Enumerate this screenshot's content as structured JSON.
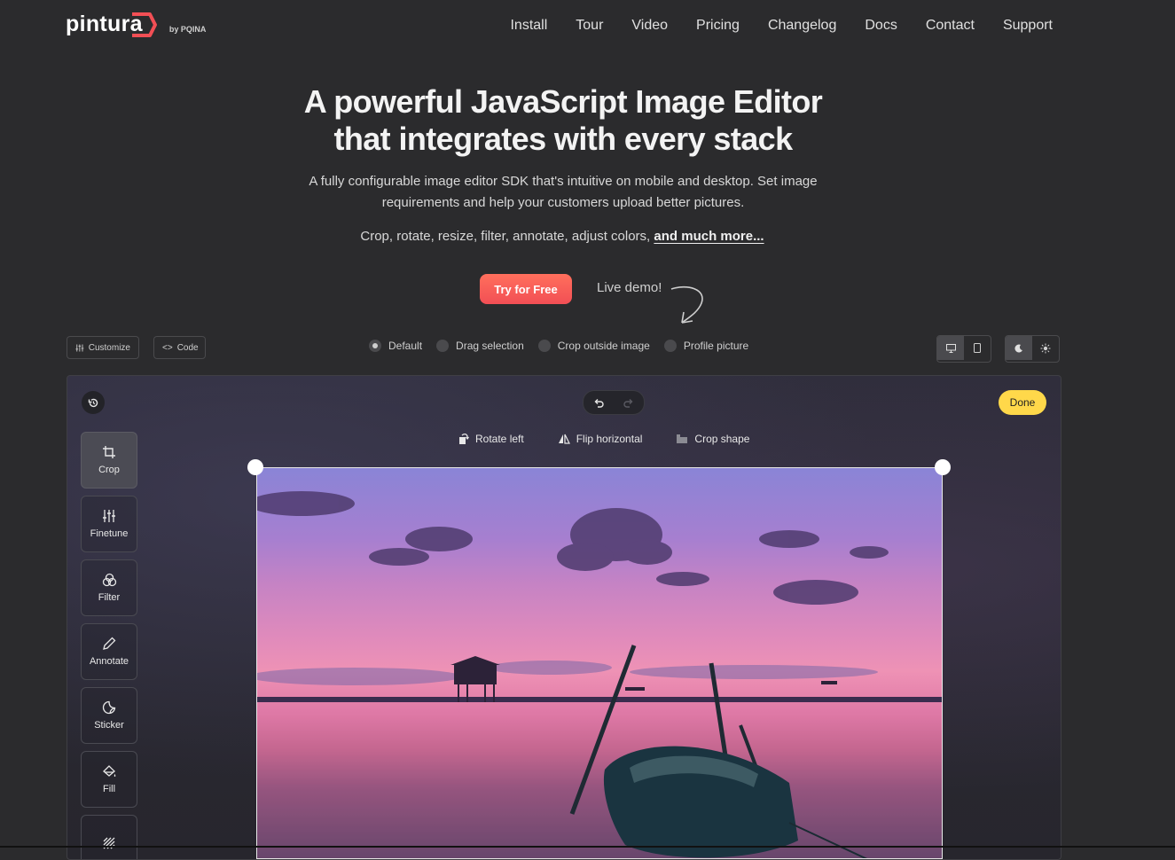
{
  "brand": {
    "name": "pintura",
    "by": "by PQINA"
  },
  "nav": [
    "Install",
    "Tour",
    "Video",
    "Pricing",
    "Changelog",
    "Docs",
    "Contact",
    "Support"
  ],
  "hero": {
    "title_line1": "A powerful JavaScript Image Editor",
    "title_line2": "that integrates with every stack",
    "subtitle": "A fully configurable image editor SDK that's intuitive on mobile and desktop. Set image requirements and help your customers upload better pictures.",
    "features": "Crop, rotate, resize, filter, annotate, adjust colors, ",
    "features_link": "and much more...",
    "cta": "Try for Free",
    "live_demo": "Live demo!"
  },
  "controls": {
    "customize": "Customize",
    "code": "Code",
    "modes": [
      "Default",
      "Drag selection",
      "Crop outside image",
      "Profile picture"
    ],
    "selected_mode": "Default"
  },
  "editor": {
    "done": "Done",
    "tools": [
      "Crop",
      "Finetune",
      "Filter",
      "Annotate",
      "Sticker",
      "Fill"
    ],
    "active_tool": "Crop",
    "crop_tools": [
      "Rotate left",
      "Flip horizontal",
      "Crop shape"
    ]
  },
  "colors": {
    "accent": "#f24f55",
    "done": "#ffd84a",
    "bg": "#2b2b2d"
  }
}
